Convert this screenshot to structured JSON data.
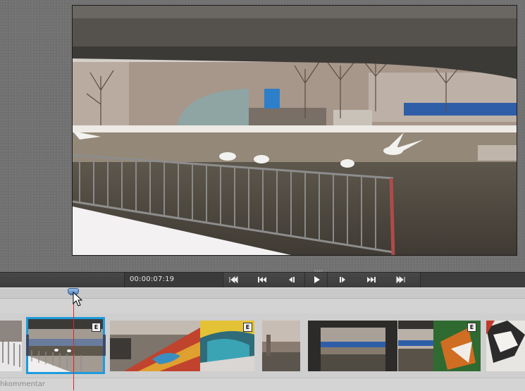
{
  "transport": {
    "timecode": "00:00:07:19",
    "buttons": [
      {
        "name": "go-to-in-button",
        "icon": "go-to-in-icon"
      },
      {
        "name": "previous-edit-button",
        "icon": "skip-back-icon"
      },
      {
        "name": "step-back-button",
        "icon": "step-back-icon"
      },
      {
        "name": "play-button",
        "icon": "play-icon"
      },
      {
        "name": "step-forward-button",
        "icon": "step-forward-icon"
      },
      {
        "name": "next-edit-button",
        "icon": "skip-forward-icon"
      },
      {
        "name": "go-to-out-button",
        "icon": "go-to-out-icon"
      }
    ]
  },
  "timeline": {
    "track_label": "hkommentar",
    "playhead_color": "#e02525",
    "selection_color": "#1d9bdd",
    "fx_badge": "E",
    "clips": [
      {
        "name": "clip-1",
        "fx": false
      },
      {
        "name": "clip-2",
        "fx": true,
        "selected": true
      },
      {
        "name": "clip-3",
        "fx": false
      },
      {
        "name": "clip-4",
        "fx": true
      },
      {
        "name": "clip-5",
        "fx": false
      },
      {
        "name": "clip-6",
        "fx": false
      },
      {
        "name": "clip-7",
        "fx": true
      },
      {
        "name": "clip-8",
        "fx": false
      }
    ]
  }
}
